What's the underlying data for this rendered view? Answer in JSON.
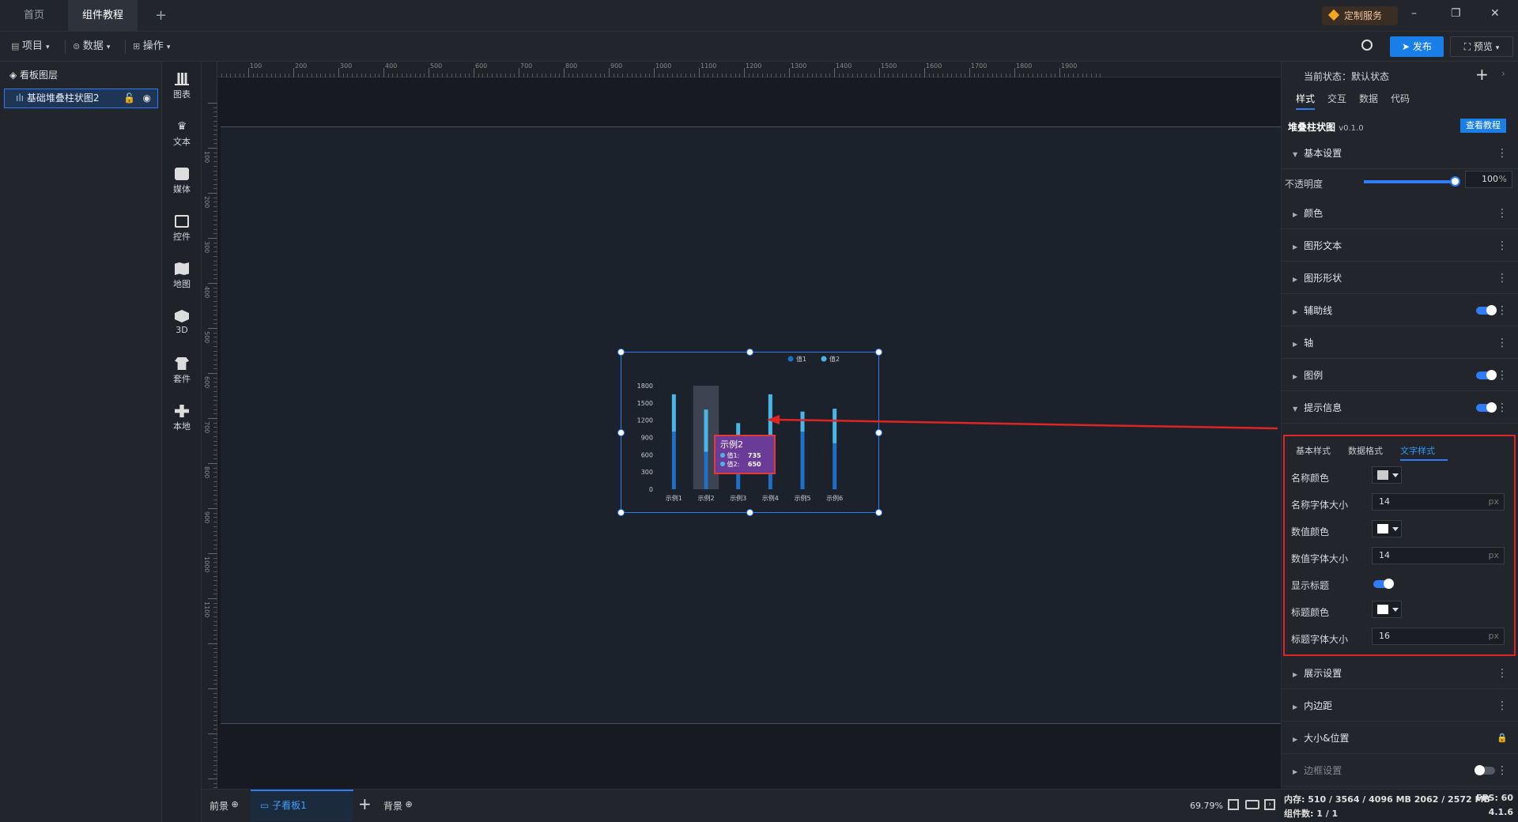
{
  "tabs": {
    "home": "首页",
    "tutorial": "组件教程",
    "add": "+"
  },
  "window": {
    "custom_service": "定制服务",
    "minimize": "–",
    "restore": "❐",
    "close": "✕"
  },
  "menu": {
    "project": "项目",
    "data": "数据",
    "operate": "操作",
    "publish": "发布",
    "preview": "预览"
  },
  "layers": {
    "title": "看板图层",
    "item": "基础堆叠柱状图2"
  },
  "toolbox": [
    "图表",
    "文本",
    "媒体",
    "控件",
    "地图",
    "3D",
    "套件",
    "本地"
  ],
  "ruler": {
    "top": [
      "100",
      "200",
      "300",
      "400",
      "500",
      "600",
      "700",
      "800",
      "900",
      "1000",
      "1100",
      "1200",
      "1300",
      "1400",
      "1500",
      "1600",
      "1700",
      "1800",
      "1900"
    ],
    "left": [
      "100",
      "200",
      "300",
      "400",
      "500",
      "600",
      "700",
      "800",
      "900",
      "1000",
      "1100"
    ]
  },
  "chart_data": {
    "type": "bar",
    "categories": [
      "示例1",
      "示例2",
      "示例3",
      "示例4",
      "示例5",
      "示例6"
    ],
    "series": [
      {
        "name": "值1",
        "values": [
          1000,
          650,
          600,
          900,
          1000,
          800
        ]
      },
      {
        "name": "值2",
        "values": [
          650,
          735,
          550,
          750,
          350,
          600
        ]
      }
    ],
    "yticks": [
      "0",
      "300",
      "600",
      "900",
      "1200",
      "1500",
      "1800"
    ],
    "ylim": [
      0,
      1800
    ],
    "legend": "top-right",
    "colors": [
      "#1f6fc6",
      "#4ab6e8"
    ],
    "highlight_category": "示例2",
    "tooltip": {
      "title": "示例2",
      "rows": [
        {
          "name": "值1:",
          "value": "735"
        },
        {
          "name": "值2:",
          "value": "650"
        }
      ]
    }
  },
  "right_panel": {
    "state_label": "当前状态：默认状态",
    "tabs": [
      "样式",
      "交互",
      "数据",
      "代码"
    ],
    "component_name": "堆叠柱状图",
    "version": "v0.1.0",
    "tutorial_button": "查看教程",
    "basic": "基本设置",
    "opacity_label": "不透明度",
    "opacity_value": "100",
    "opacity_unit": "%",
    "opacity_level": 1.0,
    "sections": [
      "颜色",
      "图形文本",
      "图形形状",
      "辅助线",
      "轴",
      "图例",
      "提示信息"
    ],
    "tooltip_tabs": [
      "基本样式",
      "数据格式",
      "文字样式"
    ],
    "fields": {
      "name_color": "名称颜色",
      "name_font": "名称字体大小",
      "name_font_value": "14",
      "value_color": "数值颜色",
      "value_font": "数值字体大小",
      "value_font_value": "14",
      "show_title": "显示标题",
      "title_color": "标题颜色",
      "title_font": "标题字体大小",
      "title_font_value": "16",
      "unit": "px"
    },
    "sections_after": [
      "展示设置",
      "内边距",
      "大小&位置",
      "边框设置"
    ]
  },
  "bottom": {
    "foreground": "前景",
    "subboard": "子看板1",
    "add": "+",
    "background": "背景",
    "zoom": "69.79%"
  },
  "status": {
    "memory": "内存:  510 / 3564 / 4096 MB  2062 / 2572 MB",
    "fps": "FPS:  60",
    "components": "组件数: 1 / 1",
    "version": "4.1.6"
  }
}
